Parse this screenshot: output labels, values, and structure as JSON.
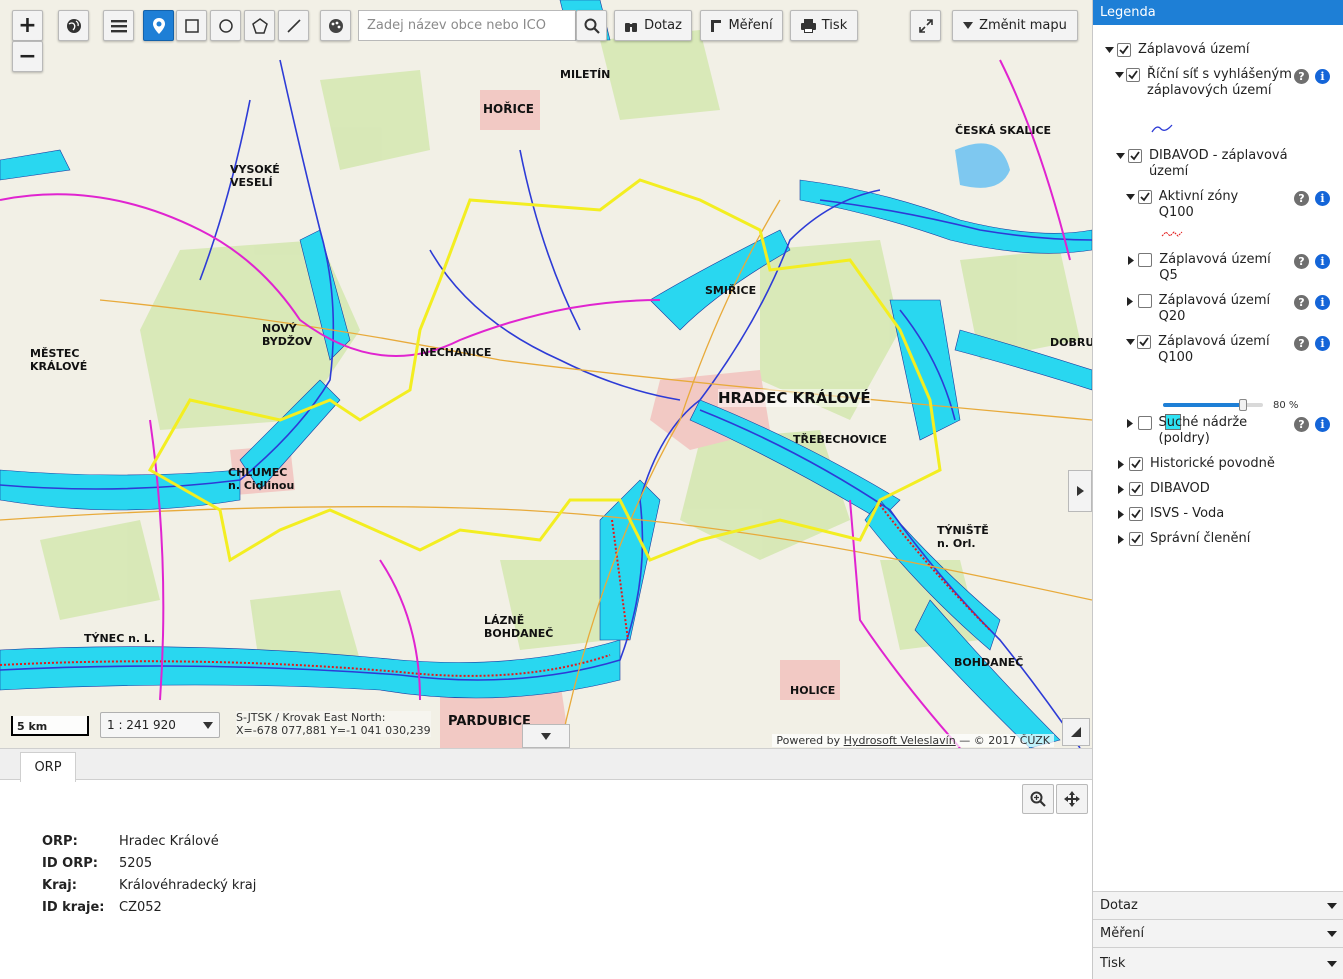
{
  "toolbar": {
    "zoom_in": "+",
    "zoom_out": "−",
    "search_placeholder": "Zadej název obce nebo IČO",
    "query_label": "Dotaz",
    "measure_label": "Měření",
    "print_label": "Tisk",
    "change_map_label": "Změnit mapu"
  },
  "map": {
    "scale_bar_label": "5 km",
    "scale_value": "1 : 241 920",
    "coords_line1": "S-JTSK / Krovak East North:",
    "coords_line2": "X=-678 077,881 Y=-1 041 030,239",
    "attribution_prefix": "Powered by ",
    "attribution_link": "Hydrosoft Veleslavín",
    "attribution_suffix": " — © 2017 ČÚZK",
    "place_labels": [
      "HRADEC KRÁLOVÉ",
      "HOŘICE",
      "NOVÝ BYDŽOV",
      "CHLUMEC n. Cidlinou",
      "MĚSTEC KRÁLOVÉ",
      "TÝNEC n. L.",
      "LÁZNĚ BOHDANEČ",
      "PARDUBICE",
      "HOLICE",
      "TÝNIŠTĚ n. Orl.",
      "BOHDANEČ",
      "NECHANICE",
      "VYSOKÉ VESELÍ",
      "MILETÍN",
      "ČESKÁ SKALICE",
      "SMIŘICE",
      "TŘEBECHOVICE",
      "DOBRUŠKA"
    ]
  },
  "info_panel": {
    "tab_label": "ORP",
    "rows": [
      {
        "key": "ORP:",
        "value": "Hradec Králové"
      },
      {
        "key": "ID ORP:",
        "value": "5205"
      },
      {
        "key": "Kraj:",
        "value": "Královéhradecký kraj"
      },
      {
        "key": "ID kraje:",
        "value": "CZ052"
      }
    ]
  },
  "legend": {
    "title": "Legenda",
    "nodes": {
      "flood": "Záplavová území",
      "river": "Říční síť s vyhlášeným záplavových území",
      "dibavod_flood": "DIBAVOD - záplavová území",
      "active_q100": "Aktivní zóny Q100",
      "q5": "Záplavová území Q5",
      "q20": "Záplavová území Q20",
      "q100": "Záplavová území Q100",
      "dry_tanks": "Suché nádrže (poldry)",
      "historic": "Historické povodně",
      "dibavod": "DIBAVOD",
      "isvs": "ISVS - Voda",
      "admin": "Správní členění"
    },
    "q100_opacity": "80 %",
    "q100_opacity_value": 80,
    "q100_color": "#2fe3f4"
  },
  "accordions": [
    "Dotaz",
    "Měření",
    "Tisk"
  ],
  "colors": {
    "accent": "#1e7fd6",
    "water": "#29d7f0",
    "boundary_yellow": "#f3ee21",
    "boundary_magenta": "#e024d0"
  }
}
